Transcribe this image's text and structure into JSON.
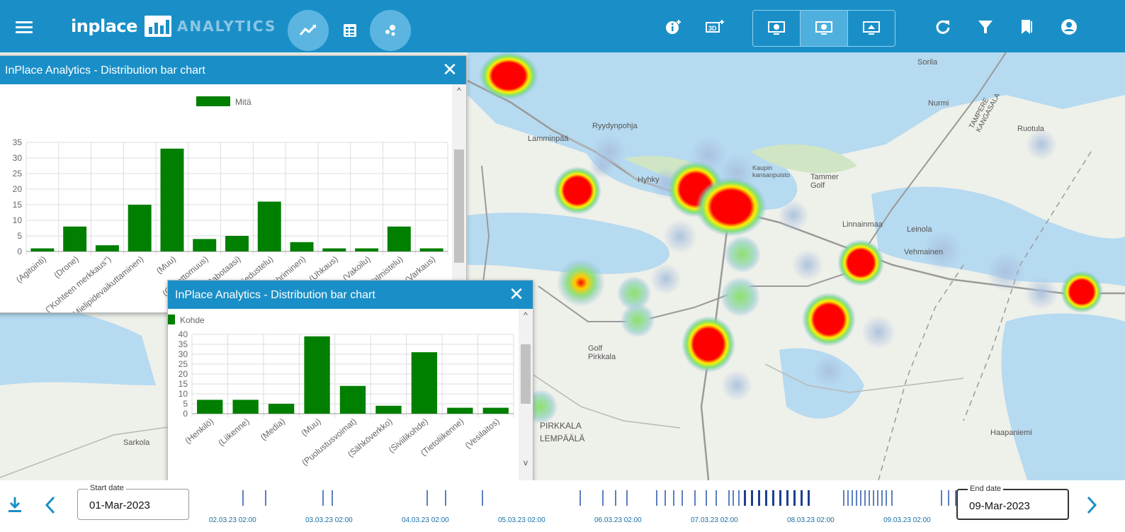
{
  "header": {
    "brand": "inplace",
    "brand_sub": "ANALYTICS",
    "view_buttons": [
      "line-chart-icon",
      "table-icon",
      "scatter-icon"
    ],
    "tools": [
      "info-plus-icon",
      "add-display-icon",
      "refresh-icon",
      "filter-icon",
      "bookmark-icon",
      "account-icon"
    ],
    "screen_options": [
      "screen-1-icon",
      "screen-2-icon",
      "screen-3-icon"
    ]
  },
  "map": {
    "labels": [
      "Sorila",
      "Nurmi",
      "Lamminpää",
      "Ryydynpohja",
      "Ruotula",
      "Hyhky",
      "Kaupin kansanpuisto",
      "Tammer Golf",
      "Linnainmaa",
      "Leinola",
      "Vehmainen",
      "Golf Pirkkala",
      "Sarkola",
      "PIRKKALA",
      "LEMPÄÄLÄ",
      "TAMPERE KANGASALA",
      "Haapaniemi"
    ]
  },
  "chart1": {
    "title": "InPlace Analytics - Distribution bar chart",
    "chart_data": {
      "type": "bar",
      "legend": "Mitä",
      "categories": [
        "(Agitointi)",
        "(Drone)",
        "(\"Kohteen merkkaus\")",
        "(Mielipidevaikuttaminen)",
        "(Muu)",
        "(Onnettomuus)",
        "(Sabotaasi)",
        "(Tiedustelu)",
        "(Töhriminen)",
        "(Uhkaus)",
        "(Vakoilu)",
        "(Valmistelu)",
        "(Varkaus)"
      ],
      "values": [
        1,
        8,
        2,
        15,
        33,
        4,
        5,
        16,
        3,
        1,
        1,
        8,
        1
      ],
      "ylim": [
        0,
        35
      ],
      "yticks": [
        0,
        5,
        10,
        15,
        20,
        25,
        30,
        35
      ],
      "color": "#007f00"
    }
  },
  "chart2": {
    "title": "InPlace Analytics - Distribution bar chart",
    "chart_data": {
      "type": "bar",
      "legend": "Kohde",
      "categories": [
        "(Henkilö)",
        "(Liikenne)",
        "(Media)",
        "(Muu)",
        "(Puolustusvoimat)",
        "(Sähköverkko)",
        "(Siviilikohde)",
        "(Tietoliikenne)",
        "(Vesilaitos)"
      ],
      "values": [
        7,
        7,
        5,
        39,
        14,
        4,
        31,
        3,
        3
      ],
      "ylim": [
        0,
        40
      ],
      "yticks": [
        0,
        5,
        10,
        15,
        20,
        25,
        30,
        35,
        40
      ],
      "color": "#007f00"
    }
  },
  "timeline": {
    "start_label": "Start date",
    "start_value": "01-Mar-2023",
    "end_label": "End date",
    "end_value": "09-Mar-2023",
    "ticks": [
      "02.03.23 02:00",
      "03.03.23 02:00",
      "04.03.23 02:00",
      "05.03.23 02:00",
      "06.03.23 02:00",
      "07.03.23 02:00",
      "08.03.23 02:00",
      "09.03.23 02:00"
    ]
  },
  "colors": {
    "accent": "#1a8fc7",
    "bar": "#007f00"
  }
}
